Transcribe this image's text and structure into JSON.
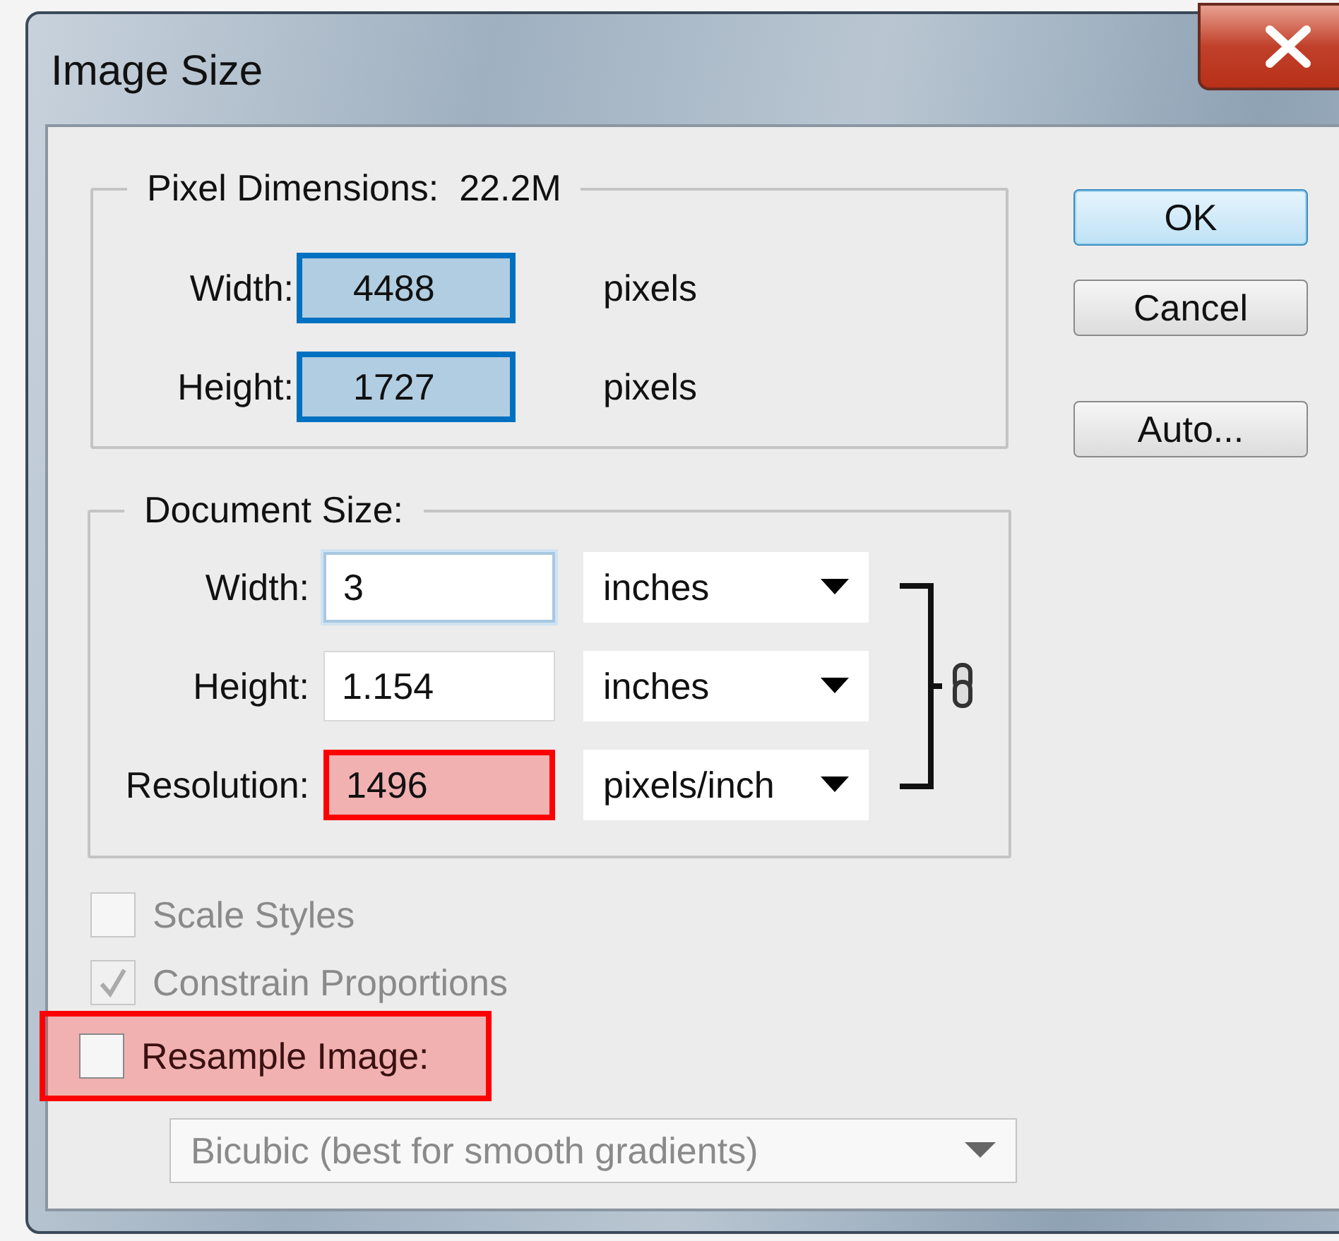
{
  "window": {
    "title": "Image Size"
  },
  "pixel_dimensions": {
    "legend": "Pixel Dimensions:",
    "size": "22.2M",
    "rows": [
      {
        "label": "Width:",
        "value": "4488",
        "unit": "pixels",
        "color": "#0070c0"
      },
      {
        "label": "Height:",
        "value": "1727",
        "unit": "pixels",
        "color": "#0070c0"
      }
    ]
  },
  "document_size": {
    "legend": "Document Size:",
    "rows": [
      {
        "label": "Width:",
        "value": "3",
        "unit": "inches",
        "focused": true
      },
      {
        "label": "Height:",
        "value": "1.154",
        "unit": "inches",
        "focused": false
      },
      {
        "label": "Resolution:",
        "value": "1496",
        "unit": "pixels/inch",
        "focused": false,
        "color": "#ff0000"
      }
    ]
  },
  "options": [
    {
      "label": "Scale Styles",
      "checked": false,
      "disabled": true
    },
    {
      "label": "Constrain Proportions",
      "checked": true,
      "disabled": true
    },
    {
      "label": "Resample Image:",
      "checked": false,
      "disabled": false,
      "color": "#ff0000"
    }
  ],
  "resample_method": {
    "value": "Bicubic (best for smooth gradients)",
    "disabled": true
  },
  "buttons": [
    {
      "label": "OK",
      "default": true
    },
    {
      "label": "Cancel",
      "default": false
    },
    {
      "label": "Auto...",
      "default": false
    }
  ]
}
